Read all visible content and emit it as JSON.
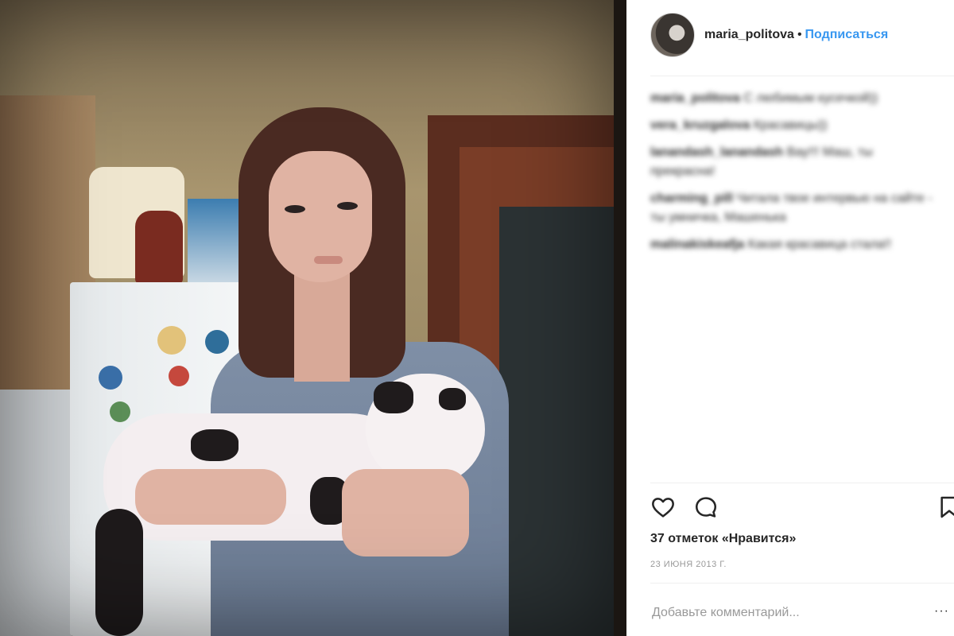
{
  "post": {
    "username": "maria_politova",
    "separator": "•",
    "follow_label": "Подписаться",
    "likes_text": "37 отметок «Нравится»",
    "date_text": "23 ИЮНЯ 2013 Г.",
    "comment_placeholder": "Добавьте комментарий...",
    "more_glyph": "···"
  },
  "comments": [
    {
      "user": "maria_politova",
      "text": "С любимым кусечкой))"
    },
    {
      "user": "vera_kruzgalova",
      "text": "Красавицы))"
    },
    {
      "user": "lanandash_lanandash",
      "text": "Вау!!! Маш, ты прекрасна!"
    },
    {
      "user": "charming_pill",
      "text": "Читала твое интервью на сайте - ты умничка, Машенька"
    },
    {
      "user": "malinakiskeafja",
      "text": "Какая красавица стала!!"
    }
  ],
  "icons": {
    "heart": "heart-icon",
    "comment": "comment-icon",
    "bookmark": "bookmark-icon"
  },
  "colors": {
    "link_blue": "#3897f0",
    "text": "#262626",
    "muted": "#999999",
    "border": "#efefef"
  }
}
